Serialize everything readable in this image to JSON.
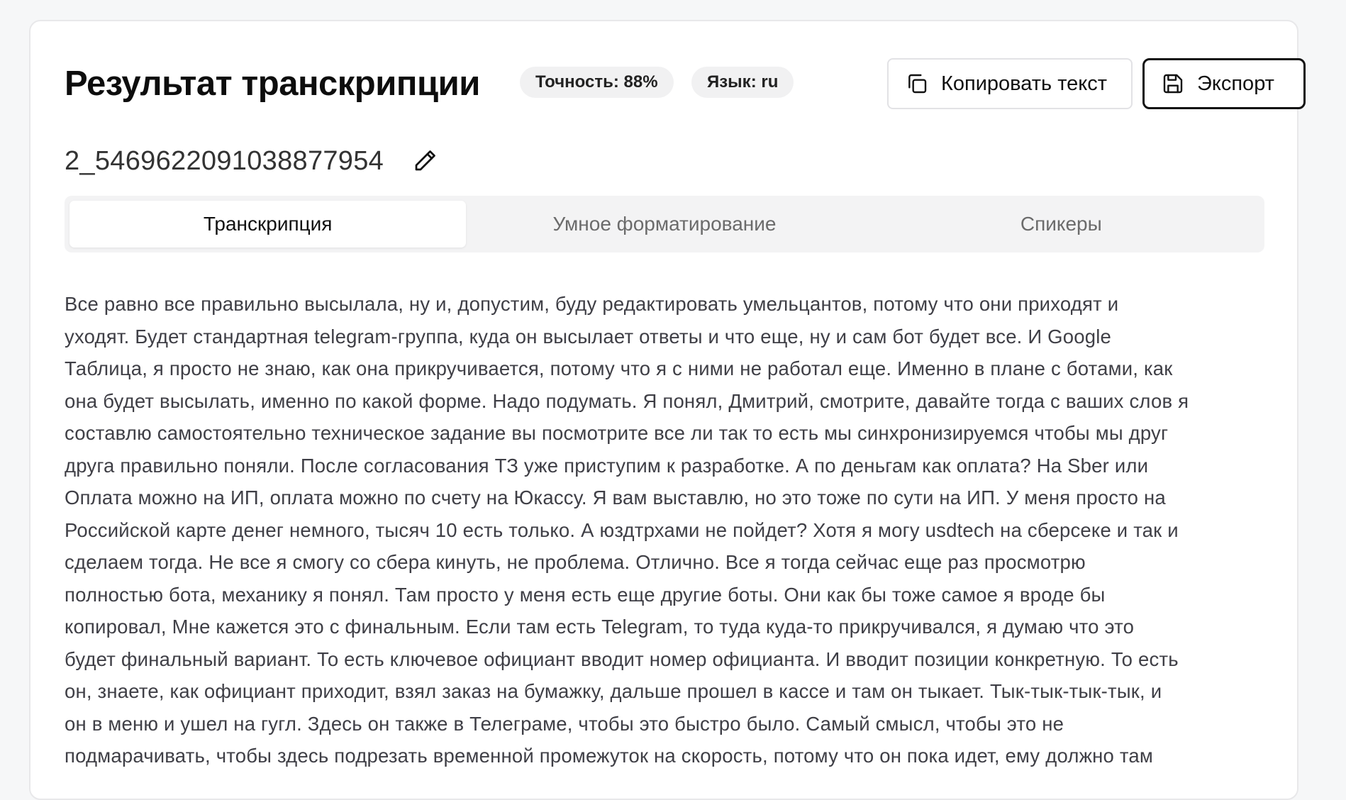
{
  "header": {
    "title": "Результат транскрипции",
    "accuracy_badge": "Точность: 88%",
    "language_badge": "Язык: ru",
    "copy_label": "Копировать текст",
    "export_label": "Экспорт"
  },
  "file": {
    "name": "2_5469622091038877954"
  },
  "tabs": [
    {
      "label": "Транскрипция",
      "active": true
    },
    {
      "label": "Умное форматирование",
      "active": false
    },
    {
      "label": "Спикеры",
      "active": false
    }
  ],
  "transcript": {
    "lines": [
      "Все равно все правильно высылала, ну и, допустим, буду редактировать умельцантов, потому что они приходят и",
      "уходят. Будет стандартная telegram-группа, куда он высылает ответы и что еще, ну и сам бот будет все. И Google",
      "Таблица, я просто не знаю, как она прикручивается, потому что я с ними не работал еще. Именно в плане с ботами, как",
      "она будет высылать, именно по какой форме. Надо подумать. Я понял, Дмитрий, смотрите, давайте тогда с ваших слов я",
      "составлю самостоятельно техническое задание вы посмотрите все ли так то есть мы синхронизируемся чтобы мы друг",
      "друга правильно поняли. После согласования ТЗ уже приступим к разработке. А по деньгам как оплата? На Sber или",
      "Оплата можно на ИП, оплата можно по счету на Юкассу. Я вам выставлю, но это тоже по сути на ИП. У меня просто на",
      "Российской карте денег немного, тысяч 10 есть только. А юздтрхами не пойдет? Хотя я могу usdtech на сберсеке и так и",
      "сделаем тогда. Не все я смогу со сбера кинуть, не проблема. Отлично. Все я тогда сейчас еще раз просмотрю",
      "полностью бота, механику я понял. Там просто у меня есть еще другие боты. Они как бы тоже самое я вроде бы",
      "копировал, Мне кажется это с финальным. Если там есть Telegram, то туда куда-то прикручивался, я думаю что это",
      "будет финальный вариант. То есть ключевое официант вводит номер официанта. И вводит позиции конкретную. То есть",
      "он, знаете, как официант приходит, взял заказ на бумажку, дальше прошел в кассе и там он тыкает. Тык-тык-тык-тык, и",
      "он в меню и ушел на гугл. Здесь он также в Телеграме, чтобы это быстро было. Самый смысл, чтобы это не",
      "подмарачивать, чтобы здесь подрезать временной промежуток на скорость, потому что он пока идет, ему должно там"
    ]
  }
}
